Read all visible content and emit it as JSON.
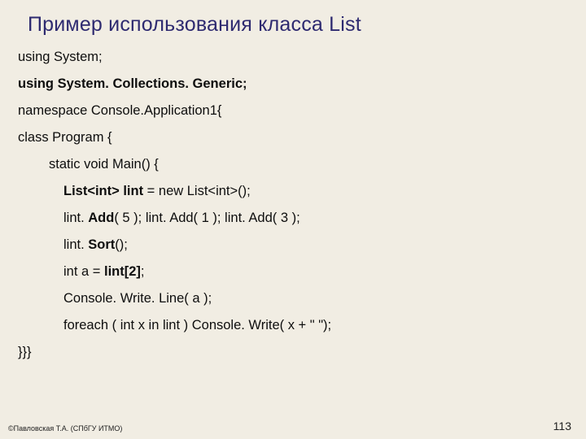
{
  "title": "Пример использования класса List",
  "code": {
    "l1": "using System;",
    "l2_pre": "using System. Collections. Generic;",
    "l3": "namespace Console.Application1{",
    "l4": "class Program {",
    "l5": "static void Main()   {",
    "l6_a": "List<int> lint",
    "l6_b": " = new List<int>();",
    "l7_a": "lint. ",
    "l7_b": "Add",
    "l7_c": "( 5 ); lint. Add( 1 ); lint. Add( 3 );",
    "l8_a": "lint. ",
    "l8_b": "Sort",
    "l8_c": "();",
    "l9_a": "int a = ",
    "l9_b": "lint[2]",
    "l9_c": ";",
    "l10": "Console. Write. Line( a );",
    "l11": "foreach ( int x in lint ) Console. Write( x + \"  \");",
    "l12": "}}}"
  },
  "footer_left": "©Павловская Т.А. (СПбГУ ИТМО)",
  "page_number": "113"
}
